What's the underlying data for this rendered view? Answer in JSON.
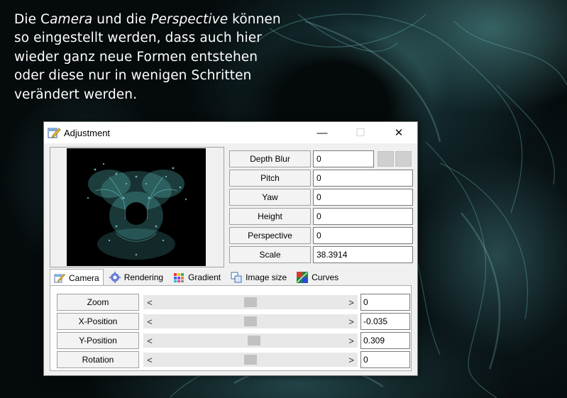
{
  "caption": {
    "line1_before": "Die C",
    "line1_italic1": "amera",
    "line1_mid": " und die ",
    "line1_italic2": "Perspective",
    "line1_after": " können",
    "line2": "so eingestellt werden, dass auch hier",
    "line3": "wieder ganz neue Formen entstehen",
    "line4": "oder diese nur in wenigen Schritten",
    "line5": "verändert werden."
  },
  "window": {
    "title": "Adjustment",
    "title_icon": "edit-document-icon",
    "minimize_glyph": "—",
    "maximize_glyph": "☐",
    "close_glyph": "✕"
  },
  "params": [
    {
      "label": "Depth Blur",
      "value": "0"
    },
    {
      "label": "Pitch",
      "value": "0"
    },
    {
      "label": "Yaw",
      "value": "0"
    },
    {
      "label": "Height",
      "value": "0"
    },
    {
      "label": "Perspective",
      "value": "0"
    },
    {
      "label": "Scale",
      "value": "38.3914"
    }
  ],
  "tabs": [
    {
      "label": "Camera",
      "icon": "camera-edit-icon",
      "active": true
    },
    {
      "label": "Rendering",
      "icon": "gear-icon",
      "active": false
    },
    {
      "label": "Gradient",
      "icon": "palette-grid-icon",
      "active": false
    },
    {
      "label": "Image size",
      "icon": "image-size-icon",
      "active": false
    },
    {
      "label": "Curves",
      "icon": "curves-icon",
      "active": false
    }
  ],
  "sliders": [
    {
      "label": "Zoom",
      "value": "0",
      "position": 0.5
    },
    {
      "label": "X-Position",
      "value": "-0.035",
      "position": 0.5
    },
    {
      "label": "Y-Position",
      "value": "0.309",
      "position": 0.52
    },
    {
      "label": "Rotation",
      "value": "0",
      "position": 0.5
    }
  ],
  "scroll_arrows": {
    "left": "<",
    "right": ">"
  },
  "colors": {
    "fractal": "#5fc9c9",
    "background": "#050a0c"
  }
}
